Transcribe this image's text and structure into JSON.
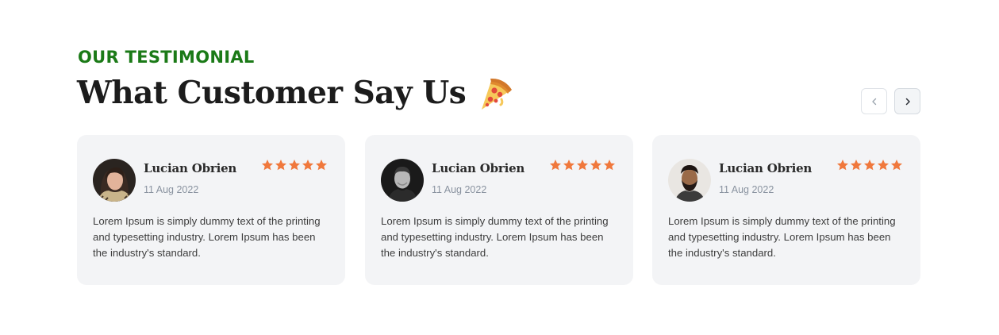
{
  "section": {
    "eyebrow": "OUR TESTIMONIAL",
    "title": "What Customer Say Us",
    "title_icon": "pizza-icon"
  },
  "carousel": {
    "prev_icon": "chevron-left-icon",
    "next_icon": "chevron-right-icon"
  },
  "colors": {
    "accent_green": "#1b7a17",
    "star_orange": "#f0783c",
    "card_bg": "#f3f4f6"
  },
  "testimonials": [
    {
      "name": "Lucian Obrien",
      "date": "11 Aug 2022",
      "rating": 5,
      "text": "Lorem Ipsum is simply dummy text of the printing and typesetting industry. Lorem Ipsum has been the industry's standard.",
      "avatar": "avatar-woman"
    },
    {
      "name": "Lucian Obrien",
      "date": "11 Aug 2022",
      "rating": 5,
      "text": "Lorem Ipsum is simply dummy text of the printing and typesetting industry. Lorem Ipsum has been the industry's standard.",
      "avatar": "avatar-man-bw"
    },
    {
      "name": "Lucian Obrien",
      "date": "11 Aug 2022",
      "rating": 5,
      "text": "Lorem Ipsum is simply dummy text of the printing and typesetting industry. Lorem Ipsum has been the industry's standard.",
      "avatar": "avatar-man-beard"
    }
  ]
}
